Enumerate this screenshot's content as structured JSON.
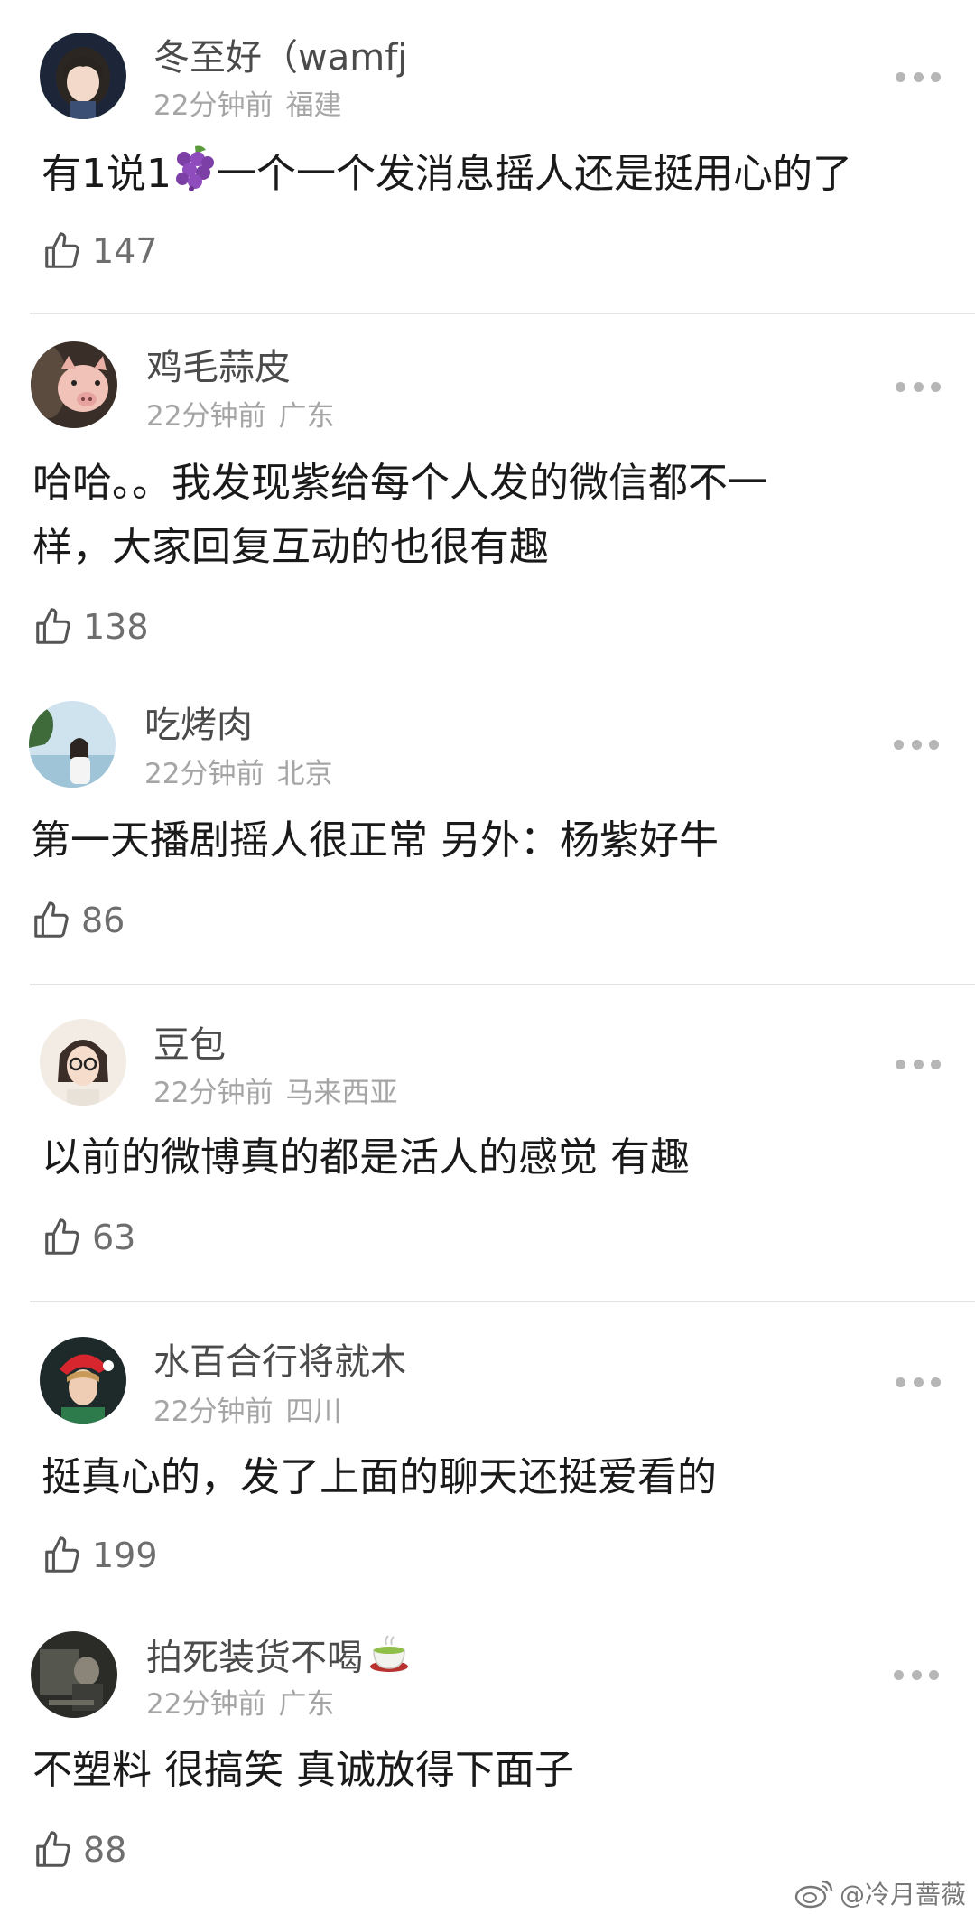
{
  "comments": [
    {
      "username": "冬至好（wamfj",
      "time": "22分钟前",
      "location": "福建",
      "text_before": "有1说1",
      "text_after": "一个一个发消息摇人还是挺用心的了",
      "likes": "147"
    },
    {
      "username": "鸡毛蒜皮",
      "time": "22分钟前",
      "location": "广东",
      "text_line1": "哈哈。。我发现紫给每个人发的微信都不一",
      "text_line2": "样，大家回复互动的也很有趣",
      "likes": "138"
    },
    {
      "username": "吃烤肉",
      "time": "22分钟前",
      "location": "北京",
      "text": "第一天播剧摇人很正常 另外：杨紫好牛",
      "likes": "86"
    },
    {
      "username": "豆包",
      "time": "22分钟前",
      "location": "马来西亚",
      "text": "以前的微博真的都是活人的感觉 有趣",
      "likes": "63"
    },
    {
      "username": "水百合行将就木",
      "time": "22分钟前",
      "location": "四川",
      "text": "挺真心的，发了上面的聊天还挺爱看的",
      "likes": "199"
    },
    {
      "username": "拍死装货不喝",
      "time": "22分钟前",
      "location": "广东",
      "text": "不塑料 很搞笑 真诚放得下面子",
      "likes": "88"
    }
  ],
  "icons": {
    "like": "thumbs-up-icon",
    "more": "more-dots-icon",
    "grape": "grape-emoji",
    "tea": "tea-emoji",
    "weibo": "weibo-logo-icon"
  },
  "watermark": {
    "text": "@冷月蔷薇"
  },
  "colors": {
    "text": "#1a1a1a",
    "username": "#4b4b4b",
    "meta": "#a5a5a5",
    "divider": "#e4e4e4"
  }
}
